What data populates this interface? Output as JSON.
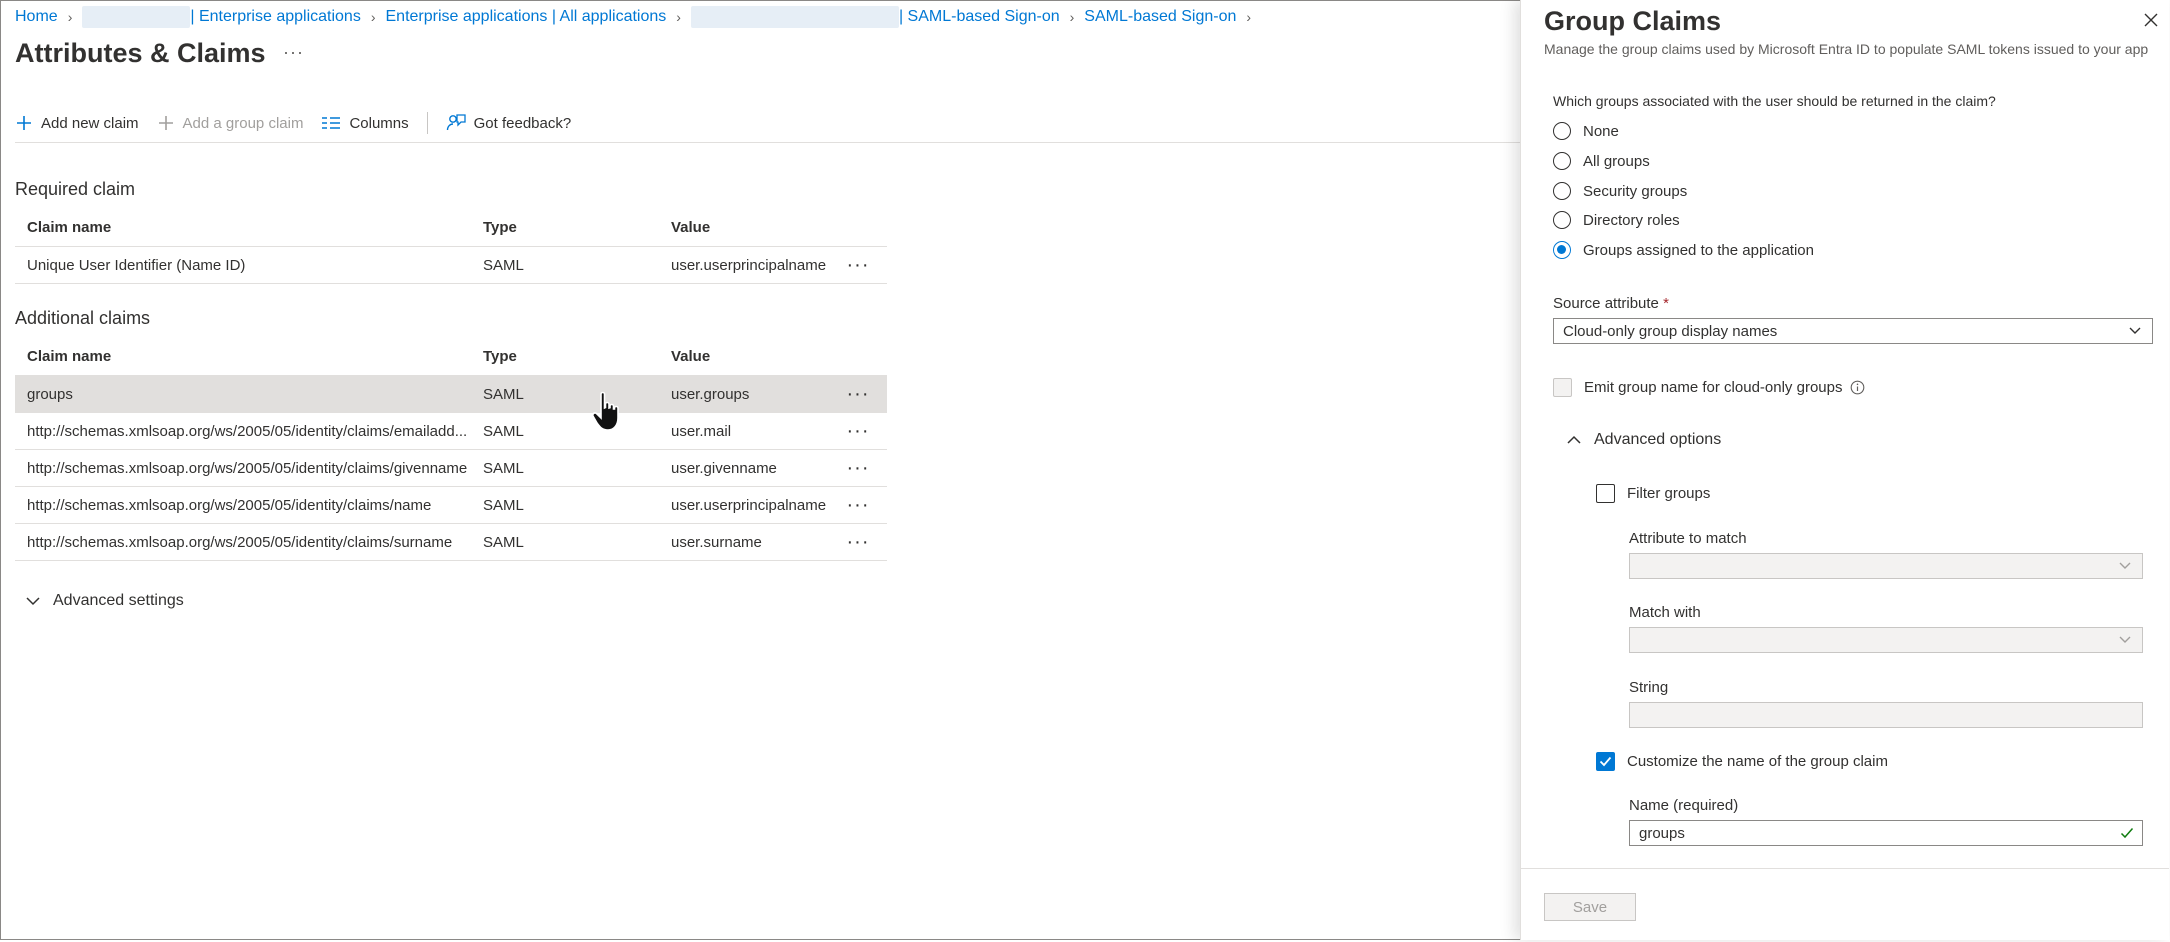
{
  "breadcrumb": {
    "home": "Home",
    "enterprise_apps": "| Enterprise applications",
    "all_apps": "Enterprise applications | All applications",
    "saml_signon": "| SAML-based Sign-on",
    "saml_signon_2": "SAML-based Sign-on"
  },
  "page": {
    "title": "Attributes & Claims",
    "more": "···"
  },
  "toolbar": {
    "add_new_claim": "Add new claim",
    "add_group_claim": "Add a group claim",
    "columns": "Columns",
    "feedback": "Got feedback?"
  },
  "required": {
    "section_title": "Required claim",
    "headers": {
      "name": "Claim name",
      "type": "Type",
      "value": "Value"
    },
    "rows": [
      {
        "name": "Unique User Identifier (Name ID)",
        "type": "SAML",
        "value": "user.userprincipalname [..."
      }
    ]
  },
  "additional": {
    "section_title": "Additional claims",
    "headers": {
      "name": "Claim name",
      "type": "Type",
      "value": "Value"
    },
    "rows": [
      {
        "name": "groups",
        "type": "SAML",
        "value": "user.groups"
      },
      {
        "name": "http://schemas.xmlsoap.org/ws/2005/05/identity/claims/emailadd...",
        "type": "SAML",
        "value": "user.mail"
      },
      {
        "name": "http://schemas.xmlsoap.org/ws/2005/05/identity/claims/givenname",
        "type": "SAML",
        "value": "user.givenname"
      },
      {
        "name": "http://schemas.xmlsoap.org/ws/2005/05/identity/claims/name",
        "type": "SAML",
        "value": "user.userprincipalname"
      },
      {
        "name": "http://schemas.xmlsoap.org/ws/2005/05/identity/claims/surname",
        "type": "SAML",
        "value": "user.surname"
      }
    ],
    "row_more": "···"
  },
  "advanced_settings": "Advanced settings",
  "panel": {
    "title": "Group Claims",
    "description": "Manage the group claims used by Microsoft Entra ID to populate SAML tokens issued to your app",
    "question": "Which groups associated with the user should be returned in the claim?",
    "options": [
      {
        "label": "None",
        "selected": false
      },
      {
        "label": "All groups",
        "selected": false
      },
      {
        "label": "Security groups",
        "selected": false
      },
      {
        "label": "Directory roles",
        "selected": false
      },
      {
        "label": "Groups assigned to the application",
        "selected": true
      }
    ],
    "source_attribute_label": "Source attribute",
    "required_mark": "*",
    "source_attribute_value": "Cloud-only group display names",
    "emit_group_name": "Emit group name for cloud-only groups",
    "advanced_options": "Advanced options",
    "filter_groups": "Filter groups",
    "attribute_to_match": "Attribute to match",
    "match_with": "Match with",
    "string_label": "String",
    "customize_name": "Customize the name of the group claim",
    "name_required": "Name (required)",
    "name_value": "groups",
    "save": "Save"
  },
  "colors": {
    "accent": "#0078d4",
    "selected_row": "#e1dfdd",
    "valid_check": "#107c10"
  }
}
